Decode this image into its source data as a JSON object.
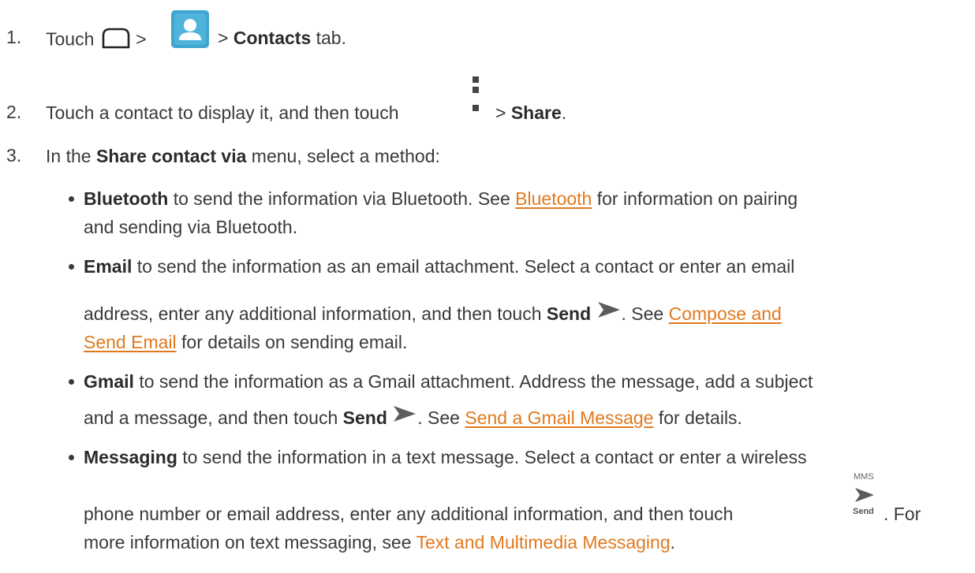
{
  "step1": {
    "num": "1.",
    "touch": "Touch",
    "sep1": ">",
    "sep2": ">",
    "contacts_tab": "Contacts",
    "tab_suffix": "tab.",
    "home_icon": "home-icon",
    "contacts_app_icon": "contacts-app-icon"
  },
  "step2": {
    "num": "2.",
    "text": "Touch a contact to display it, and then touch",
    "sep": ">",
    "share": "Share",
    "period": ".",
    "menu_icon": "overflow-menu-icon"
  },
  "step3": {
    "num": "3.",
    "prefix": "In the",
    "menu_name": "Share contact via",
    "suffix": "menu, select a method:"
  },
  "bluetooth": {
    "term": "Bluetooth",
    "text1": "to send the information via Bluetooth. See",
    "link": "Bluetooth",
    "text2": "for information on pairing",
    "line2": "and sending via Bluetooth."
  },
  "email": {
    "term": "Email",
    "line1": "to send the information as an email attachment. Select a contact or enter an email",
    "line2a": "address, enter any additional information, and then touch",
    "send": "Send",
    "see": ". See",
    "link_a": "Compose and",
    "link_b": "Send Email",
    "line3": "for details on sending email."
  },
  "gmail": {
    "term": "Gmail",
    "line1": "to send the information as a Gmail attachment. Address the message, add a subject",
    "line2a": "and a message, and then touch",
    "send": "Send",
    "see": ". See",
    "link": "Send a Gmail Message",
    "tail": "for details."
  },
  "messaging": {
    "term": "Messaging",
    "line1": "to send the information in a text message. Select a contact or enter a wireless",
    "line2": "phone number or email address, enter any additional information, and then touch",
    "mms_label": "MMS",
    "send_label": "Send",
    "for": ". For",
    "line3": "more information on text messaging, see",
    "link": "Text and Multimedia Messaging",
    "period": "."
  },
  "colors": {
    "text": "#3a3a3a",
    "link": "#e07a1f",
    "contacts_icon_bg": "#3fa6cf",
    "send_icon": "#5c5c5c"
  }
}
